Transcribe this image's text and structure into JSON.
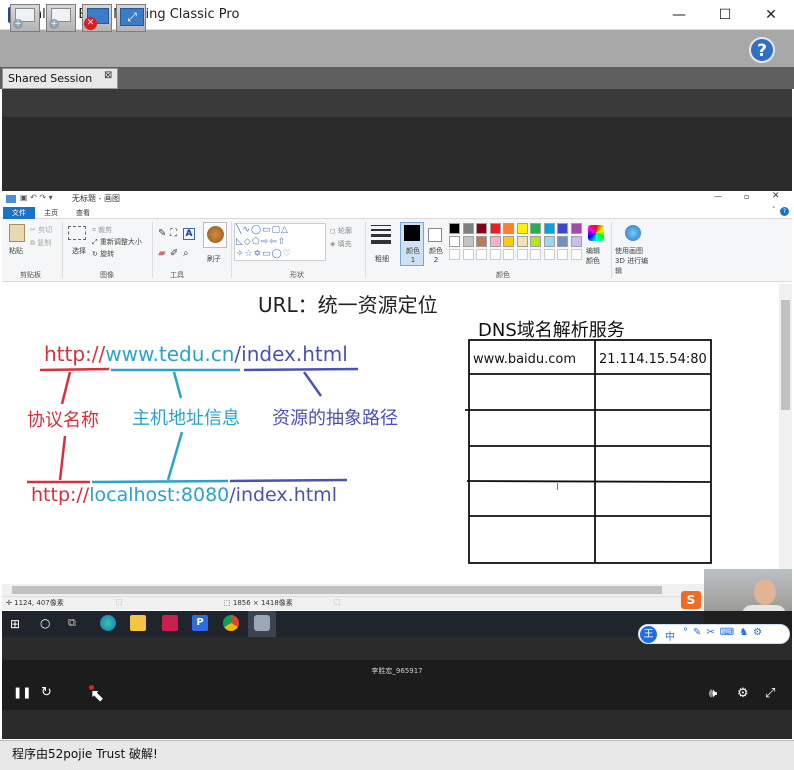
{
  "window": {
    "title": "Inletex Easy Meeting Classic Pro",
    "icon_text": "IL",
    "minimize": "—",
    "maximize": "☐",
    "close": "✕"
  },
  "toolbar": {
    "buttons": [
      "add-screen",
      "add-window",
      "stop-sharing",
      "fit-screen"
    ],
    "help": "?"
  },
  "tab": {
    "label": "Shared Session",
    "close": "⊠"
  },
  "paint": {
    "title": "无标题 - 画图",
    "tabs": [
      "文件",
      "主页",
      "查看"
    ],
    "groups": [
      "剪贴板",
      "图像",
      "工具",
      "形状",
      "颜色"
    ],
    "clipboard": {
      "paste": "粘贴",
      "cut": "剪切",
      "copy": "复制"
    },
    "image": {
      "select": "选择",
      "crop": "裁剪",
      "resize": "重新调整大小",
      "rotate": "旋转"
    },
    "brushes": "刷子",
    "outline": "轮廓",
    "fill": "填充",
    "size": "粗细",
    "color1": "颜色 1",
    "color2": "颜色 2",
    "edit_colors": "编辑颜色",
    "paint3d": "使用画图 3D 进行编辑",
    "status_pos": "1124, 407像素",
    "status_size": "1856 × 1418像素",
    "swatches_row1": [
      "#000000",
      "#7f7f7f",
      "#880015",
      "#ed1c24",
      "#ff7f27",
      "#fff200",
      "#22b14c",
      "#00a2e8",
      "#3f48cc",
      "#a349a4"
    ],
    "swatches_row2": [
      "#ffffff",
      "#c3c3c3",
      "#b97a57",
      "#ffaec9",
      "#ffc90e",
      "#efe4b0",
      "#b5e61d",
      "#99d9ea",
      "#7092be",
      "#c8bfe7"
    ]
  },
  "drawing": {
    "heading": "URL：统一资源定位",
    "url1": {
      "protocol": "http://",
      "host": "www.tedu.cn",
      "path": "/index.html"
    },
    "labels": {
      "protocol": "协议名称",
      "host": "主机地址信息",
      "path": "资源的抽象路径"
    },
    "url2": {
      "protocol": "http://",
      "host": "localhost:8080",
      "path": "/index.html"
    },
    "dns_title": "DNS域名解析服务",
    "dns_rows": [
      [
        "www.baidu.com",
        "21.114.15.54:80"
      ],
      [
        "",
        ""
      ],
      [
        "",
        ""
      ],
      [
        "",
        ""
      ],
      [
        "",
        ""
      ],
      [
        "",
        ""
      ]
    ],
    "cursor_mark": "I",
    "colors": {
      "protocol": "#d6303c",
      "host": "#2aa3c9",
      "path": "#4a52b3"
    }
  },
  "video": {
    "title": "李胜宏_965917",
    "pause": "❚❚",
    "replay": "↻"
  },
  "ime": {
    "label": "王",
    "mid": "中"
  },
  "status": {
    "text": "程序由52pojie Trust 破解!"
  }
}
